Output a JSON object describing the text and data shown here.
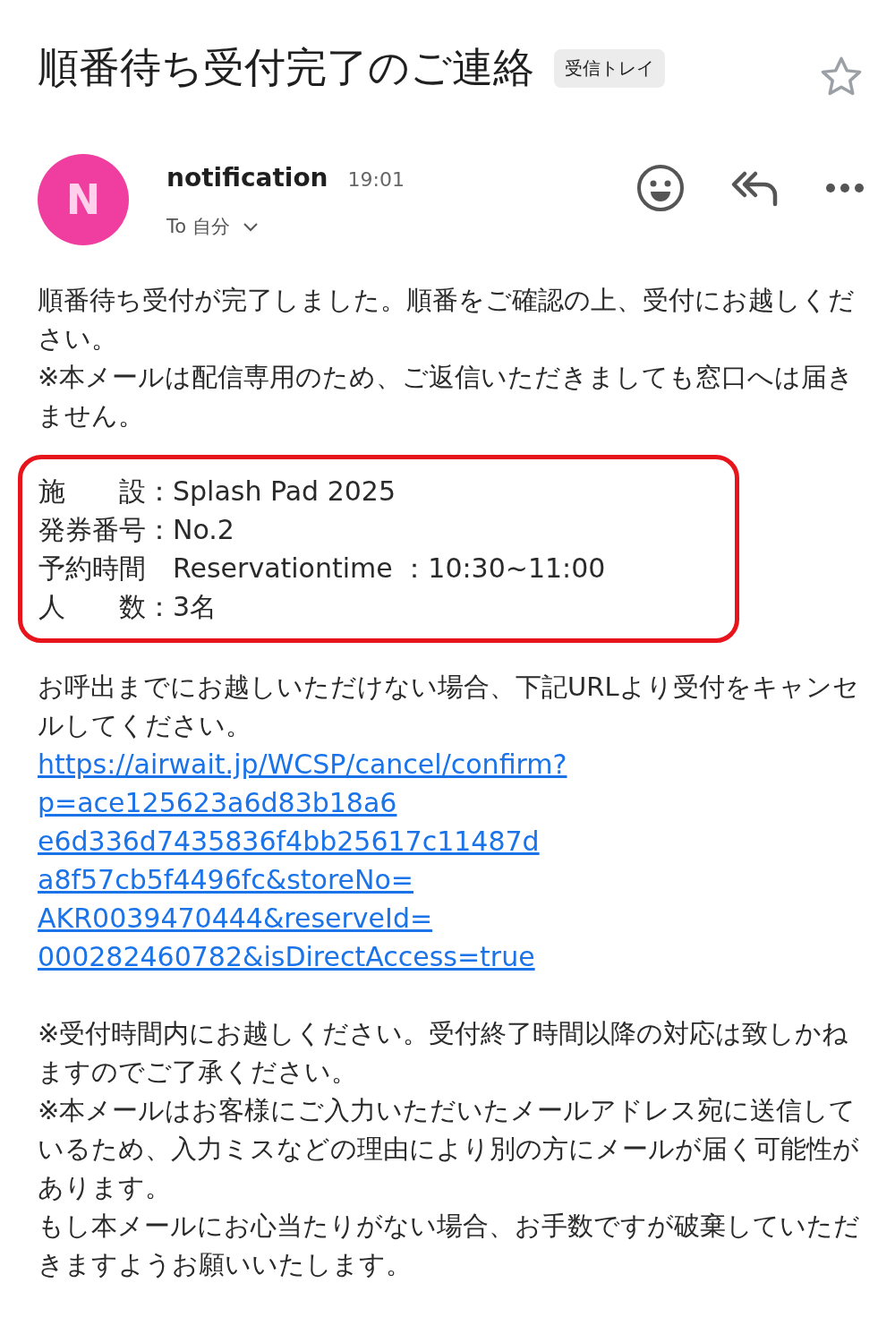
{
  "subject": "順番待ち受付完了のご連絡",
  "label": "受信トレイ",
  "starred": false,
  "sender": {
    "initial": "N",
    "color": "#f03ea0",
    "name": "notification",
    "time": "19:01",
    "to": "To 自分"
  },
  "paragraphs_top": [
    "順番待ち受付が完了しました。順番をご確認の上、受付にお越しください。",
    "※本メールは配信専用のため、ご返信いただきましても窓口へは届きません。"
  ],
  "details": [
    "施　　設：Splash Pad 2025",
    "発券番号：No.2",
    "予約時間　Reservationtime ：10:30~11:00",
    "人　　数：3名"
  ],
  "cancel_text": "お呼出までにお越しいただけない場合、下記URLより受付をキャンセルしてください。",
  "cancel_link": [
    "https://airwait.jp/WCSP/cancel/confirm?",
    "p=ace125623a6d83b18a6",
    "e6d336d7435836f4bb25617c11487d",
    "a8f57cb5f4496fc&storeNo=",
    "AKR0039470444&reserveId=",
    "000282460782&isDirectAccess=true"
  ],
  "paragraphs_bottom": [
    "※受付時間内にお越しください。受付終了時間以降の対応は致しかねますのでご了承ください。",
    "※本メールはお客様にご入力いただいたメールアドレス宛に送信しているため、入力ミスなどの理由により別の方にメールが届く可能性があります。",
    "もし本メールにお心当たりがない場合、お手数ですが破棄していただきますようお願いいたします。"
  ]
}
